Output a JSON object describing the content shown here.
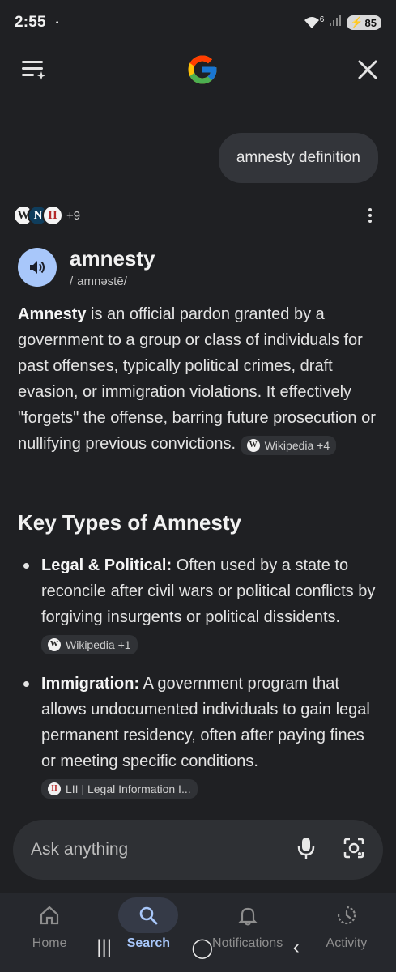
{
  "status": {
    "time": "2:55",
    "dot": "•",
    "wifi_badge": "6",
    "battery": "85"
  },
  "query": "amnesty definition",
  "sources": {
    "avatars": [
      {
        "letter": "W",
        "bg": "#f4f4f4",
        "fg": "#222222"
      },
      {
        "letter": "N",
        "bg": "#0f3d5c",
        "fg": "#ffffff"
      },
      {
        "letter": "II",
        "bg": "#f4f4f4",
        "fg": "#b42b2b"
      }
    ],
    "more": "+9"
  },
  "word": {
    "title": "amnesty",
    "phonetic": "/ˈamnəstē/"
  },
  "answer": {
    "term": "Amnesty",
    "text": " is an official pardon granted by a government to a group or class of individuals for past offenses, typically political crimes, draft evasion, or immigration violations. It effectively \"forgets\" the offense, barring future prosecution or nullifying previous convictions. ",
    "chip": "Wikipedia +4",
    "chip_icon": "W"
  },
  "section_title": "Key Types of Amnesty",
  "types": [
    {
      "term": "Legal & Political:",
      "text": " Often used by a state to reconcile after civil wars or political conflicts by forgiving insurgents or political dissidents. ",
      "chip": "Wikipedia +1",
      "chip_icon": "W"
    },
    {
      "term": "Immigration:",
      "text": " A government program that allows undocumented individuals to gain legal permanent residency, often after paying fines or meeting specific conditions. ",
      "chip": "LII | Legal Information I...",
      "chip_icon": "II"
    }
  ],
  "ask": {
    "placeholder": "Ask anything"
  },
  "nav": [
    {
      "label": "Home",
      "icon": "home-icon"
    },
    {
      "label": "Search",
      "icon": "search-icon",
      "active": true
    },
    {
      "label": "Notifications",
      "icon": "bell-icon"
    },
    {
      "label": "Activity",
      "icon": "activity-icon"
    }
  ],
  "sys_nav": {
    "recents": "|||",
    "home": "◯",
    "back": "‹"
  },
  "colors": {
    "accent": "#a8c7fa",
    "background": "#1f2023",
    "surface": "#2e3034"
  }
}
